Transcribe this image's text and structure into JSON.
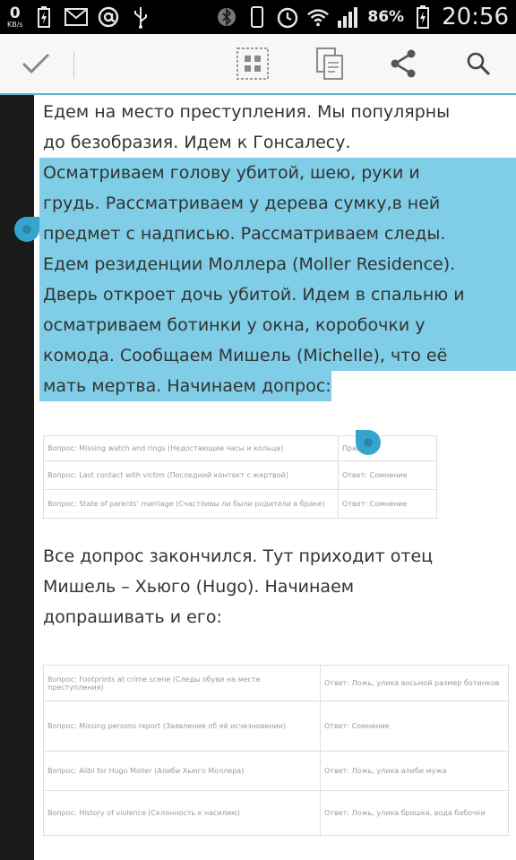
{
  "status_bar": {
    "speed_value": "0",
    "speed_unit": "KB/s",
    "battery_percent": "86%",
    "time": "20:56",
    "left_icons": [
      "battery-icon",
      "mail-icon",
      "at-icon",
      "usb-icon"
    ],
    "right_icons": [
      "bluetooth-icon",
      "vibrate-icon",
      "alarm-icon",
      "wifi-icon",
      "signal-icon",
      "battery-charging-icon"
    ]
  },
  "action_bar": {
    "icons": [
      "check-icon",
      "select-all-icon",
      "copy-icon",
      "share-icon",
      "search-icon"
    ],
    "accent_color": "#5ab7d6"
  },
  "content": {
    "para1_lines": [
      "Едем на место преступления. Мы популярны",
      "до безобразия. Идем к Гонсалесу."
    ],
    "selected_lines": [
      "Осматриваем голову убитой, шею, руки и",
      "грудь. Рассматриваем у дерева сумку,в ней",
      "предмет с надписью. Рассматриваем следы.",
      "Едем резиденции Моллера (Moller Residence).",
      "Дверь откроет дочь убитой. Идем в спальню и",
      "осматриваем ботинки у окна, коробочки у",
      "комода. Сообщаем Мишель (Michelle), что её",
      "мать мертва. Начинаем допрос:"
    ],
    "selection_color": "#7fcde6",
    "table1": [
      [
        "Вопрос: Missing watch and rings (Недостающие часы и кольца)",
        "Правда"
      ],
      [
        "Вопрос: Last contact with victim (Последний контакт с жертвой)",
        "Ответ: Сомнение"
      ],
      [
        "Вопрос: State of parents' marriage (Счастливы ли были родители в браке)",
        "Ответ: Сомнение"
      ]
    ],
    "para2_lines": [
      "Все допрос закончился. Тут приходит отец",
      "Мишель – Хьюго (Hugo). Начинаем",
      "допрашивать и его:"
    ],
    "table2": [
      [
        "Вопрос: Footprints at crime scene (Следы обуви на месте преступления)",
        "Ответ: Ложь, улика восьмой размер ботинков"
      ],
      [
        "Вопрос: Missing persons report (Заявление об её исчезновении)",
        "Ответ: Сомнение"
      ],
      [
        "Вопрос: Alibi for Hugo Moller (Алиби Хьюго Моллера)",
        "Ответ: Ложь, улика алиби мужа"
      ],
      [
        "Вопрос: History of violence (Склонность к насилию)",
        "Ответ: Ложь, улика брошка, вода бабочки"
      ]
    ]
  }
}
